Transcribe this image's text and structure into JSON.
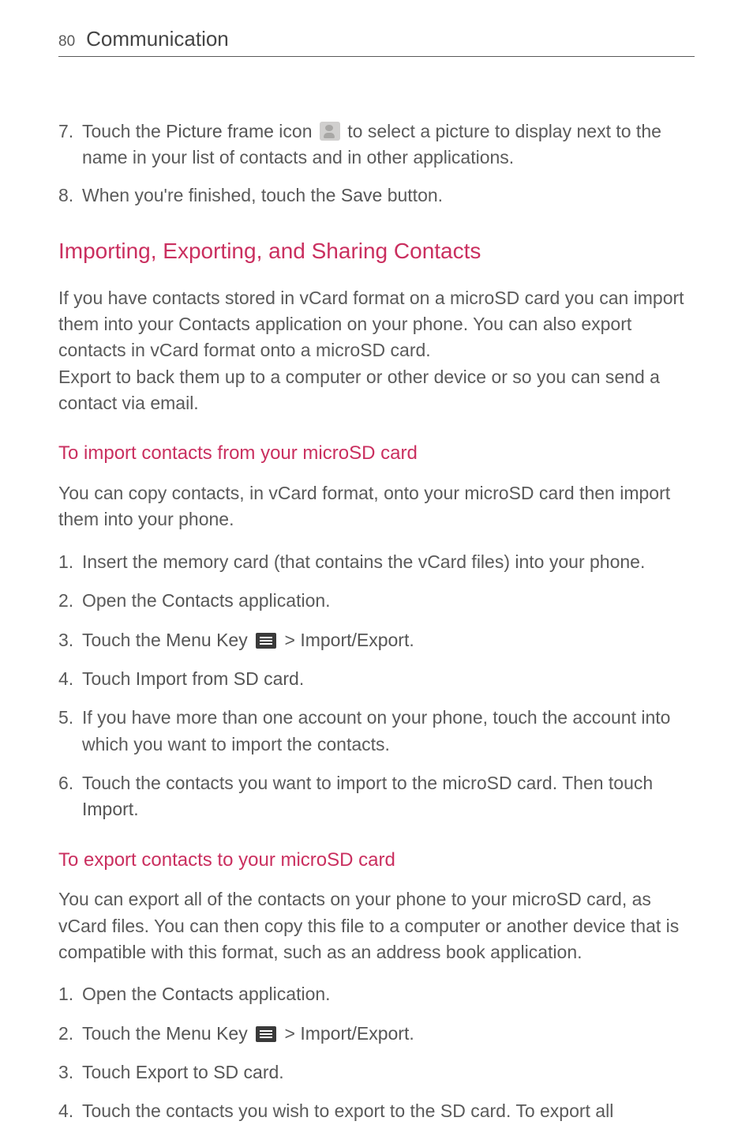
{
  "header": {
    "page_number": "80",
    "title": "Communication"
  },
  "top_list": {
    "item7": {
      "num": "7.",
      "pre": "Touch the ",
      "bold1": "Picture frame",
      "mid1": " icon ",
      "post": " to select a picture to display next to the name in your list of contacts and in other applications."
    },
    "item8": {
      "num": "8.",
      "pre": "When you're finished, touch the ",
      "bold1": "Save",
      "post": " button."
    }
  },
  "h2_importing": "Importing, Exporting, and Sharing Contacts",
  "para_importing_1": "If you have contacts stored in vCard format on a microSD card you can import them into your Contacts application on your phone. You can also export contacts in vCard format onto a microSD card.",
  "para_importing_2": "Export to back them up to a computer or other device or so you can send a contact via email.",
  "h3_import": "To import contacts from your microSD card",
  "para_import_intro": "You can copy contacts, in vCard format, onto your microSD card then import them into your phone.",
  "import_steps": {
    "s1": {
      "num": "1.",
      "text": "Insert the memory card (that contains the vCard files) into your phone."
    },
    "s2": {
      "num": "2.",
      "pre": "Open the ",
      "bold": "Contacts",
      "post": " application."
    },
    "s3": {
      "num": "3.",
      "pre": "Touch the ",
      "bold1": "Menu Key ",
      "mid": " > ",
      "bold2": "Import/Export",
      "post": "."
    },
    "s4": {
      "num": "4.",
      "pre": "Touch ",
      "bold": "Import from SD card",
      "post": "."
    },
    "s5": {
      "num": "5.",
      "text": "If you have more than one account on your phone, touch the account into which you want to import the contacts."
    },
    "s6": {
      "num": "6.",
      "pre": "Touch the contacts you want to import to the microSD card. Then touch ",
      "bold": "Import",
      "post": "."
    }
  },
  "h3_export": "To export contacts to your microSD card",
  "para_export_intro": "You can export all of the contacts on your phone to your microSD card, as vCard files. You can then copy this file to a computer or another device that is compatible with this format, such as an address book application.",
  "export_steps": {
    "s1": {
      "num": "1.",
      "pre": "Open the ",
      "bold": "Contacts",
      "post": " application."
    },
    "s2": {
      "num": "2.",
      "pre": "Touch the ",
      "bold1": "Menu Key ",
      "mid": " > ",
      "bold2": "Import/Export",
      "post": "."
    },
    "s3": {
      "num": "3.",
      "pre": "Touch ",
      "bold": "Export to SD card",
      "post": "."
    },
    "s4": {
      "num": "4.",
      "text": "Touch the contacts you wish to export to the SD card. To export all"
    }
  }
}
